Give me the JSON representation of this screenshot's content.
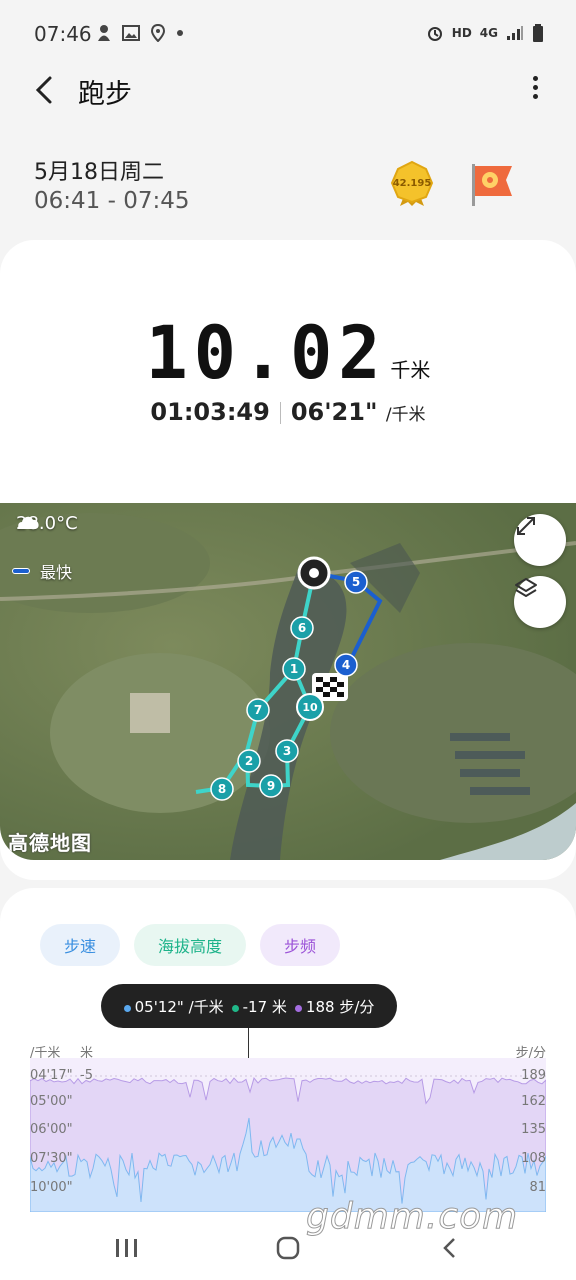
{
  "status_bar": {
    "time": "07:46",
    "network_hd": "HD",
    "network_4g": "4G"
  },
  "header": {
    "title": "跑步"
  },
  "session": {
    "date": "5月18日周二",
    "time_range": "06:41 - 07:45",
    "badge_medal_text": "42.195"
  },
  "summary": {
    "distance": "10.02",
    "distance_unit": "千米",
    "duration": "01:03:49",
    "pace": "06'21\"",
    "pace_unit": "/千米"
  },
  "map": {
    "weather": "28.0°C",
    "legend_label": "最快",
    "watermark": "高德地图",
    "markers": [
      "1",
      "2",
      "3",
      "4",
      "5",
      "6",
      "7",
      "8",
      "9",
      "10"
    ]
  },
  "chart": {
    "tabs": [
      "步速",
      "海拔高度",
      "步频"
    ],
    "tooltip": {
      "pace": "05'12\" /千米",
      "altitude": "-17 米",
      "cadence": "188 步/分"
    },
    "left_axis_title": "/千米",
    "mid_axis_title": "米",
    "right_axis_title": "步/分",
    "pace_ticks": [
      "04'17\"",
      "05'00\"",
      "06'00\"",
      "07'30\"",
      "10'00\""
    ],
    "alt_ticks": [
      "-5"
    ],
    "cadence_ticks": [
      "189",
      "162",
      "135",
      "108",
      "81"
    ],
    "colors": {
      "pace": "#5aa8ee",
      "altitude": "#20b889",
      "cadence": "#a46de0"
    }
  },
  "watermark_site": "gdmm.com"
}
